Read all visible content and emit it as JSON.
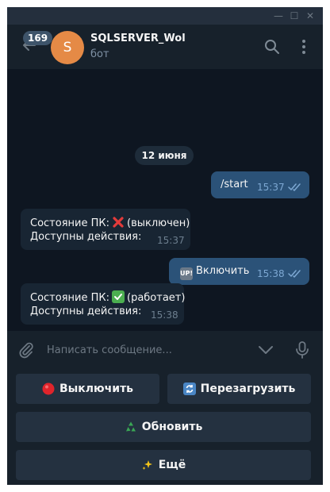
{
  "window": {
    "minimize_glyph": "—",
    "maximize_glyph": "☐",
    "close_glyph": "✕"
  },
  "header": {
    "unread_count": "169",
    "avatar_letter": "S",
    "avatar_color": "#e58a46",
    "chat_title": "SQLSERVER_Wol",
    "chat_subtitle": "бот",
    "icons": [
      "back-arrow-icon",
      "search-icon",
      "more-vertical-icon"
    ]
  },
  "messages": {
    "date_label": "12 июня",
    "items": [
      {
        "direction": "out",
        "text": "/start",
        "time": "15:37",
        "read": true
      },
      {
        "direction": "in",
        "line1_prefix": "Состояние ПК:",
        "line1_emoji": "cross-mark",
        "line1_suffix": "(выключен)",
        "line2": "Доступны действия:",
        "time": "15:37"
      },
      {
        "direction": "out",
        "emoji": "up-button",
        "emoji_text": "UP!",
        "text": "Включить",
        "time": "15:38",
        "read": true
      },
      {
        "direction": "in",
        "line1_prefix": "Состояние ПК:",
        "line1_emoji": "check-mark",
        "line1_suffix": "(работает)",
        "line2": "Доступны действия:",
        "time": "15:38"
      }
    ]
  },
  "composer": {
    "placeholder": "Написать сообщение...",
    "icons": [
      "attach-icon",
      "chevron-down-icon",
      "microphone-icon"
    ]
  },
  "keyboard": {
    "buttons": [
      {
        "label": "Выключить",
        "icon": "red-circle-icon"
      },
      {
        "label": "Перезагрузить",
        "icon": "refresh-icon"
      },
      {
        "label": "Обновить",
        "icon": "recycle-icon"
      },
      {
        "label": "Ещё",
        "icon": "sparkles-icon"
      }
    ]
  },
  "colors": {
    "background": "#0e1621",
    "panel": "#17212b",
    "outgoing_bubble": "#2b5278",
    "incoming_bubble": "#182533",
    "keyboard_button": "#243140"
  }
}
